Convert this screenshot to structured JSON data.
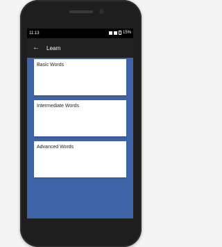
{
  "status_bar": {
    "time": "11:13",
    "battery_percent": "15%"
  },
  "app_bar": {
    "back_icon": "arrow-left",
    "title": "Learn"
  },
  "cards": [
    {
      "label": "Basic Words"
    },
    {
      "label": "Intermediate Words"
    },
    {
      "label": "Advanced Words"
    }
  ],
  "colors": {
    "screen_background": "#3f65a8",
    "app_bar": "#212121",
    "status_bar": "#000000",
    "card": "#ffffff"
  }
}
